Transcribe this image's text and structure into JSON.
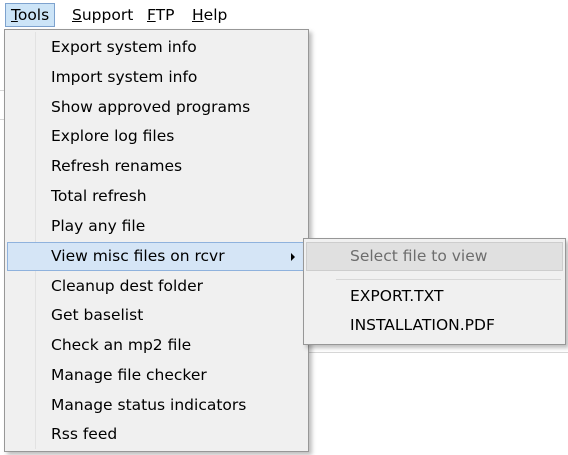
{
  "menubar": {
    "items": [
      {
        "label": "Tools",
        "accel": "T",
        "rest": "ools",
        "active": true
      },
      {
        "label": "Support",
        "accel": "S",
        "rest": "upport",
        "active": false
      },
      {
        "label": "FTP",
        "accel": "F",
        "rest": "TP",
        "active": false
      },
      {
        "label": "Help",
        "accel": "H",
        "rest": "elp",
        "active": false
      }
    ]
  },
  "tools_menu": {
    "items": [
      {
        "label": "Export system info"
      },
      {
        "label": "Import system info"
      },
      {
        "label": "Show approved programs"
      },
      {
        "label": "Explore log files"
      },
      {
        "label": "Refresh renames"
      },
      {
        "label": "Total refresh"
      },
      {
        "label": "Play any file"
      },
      {
        "label": "View misc files on rcvr",
        "has_submenu": true,
        "highlighted": true
      },
      {
        "label": "Cleanup dest folder"
      },
      {
        "label": "Get baselist"
      },
      {
        "label": "Check an mp2 file"
      },
      {
        "label": "Manage file checker"
      },
      {
        "label": "Manage status indicators"
      },
      {
        "label": "Rss feed"
      }
    ]
  },
  "submenu": {
    "header": "Select file to view",
    "items": [
      {
        "label": "EXPORT.TXT"
      },
      {
        "label": "INSTALLATION.PDF"
      }
    ]
  },
  "colors": {
    "highlight_bg": "#d5e5f6",
    "highlight_border": "#8fb2dd",
    "menu_bg": "#f0f0f0",
    "disabled_text": "#6d6d6d"
  },
  "icons": {
    "submenu_arrow": "chevron-right-icon"
  }
}
